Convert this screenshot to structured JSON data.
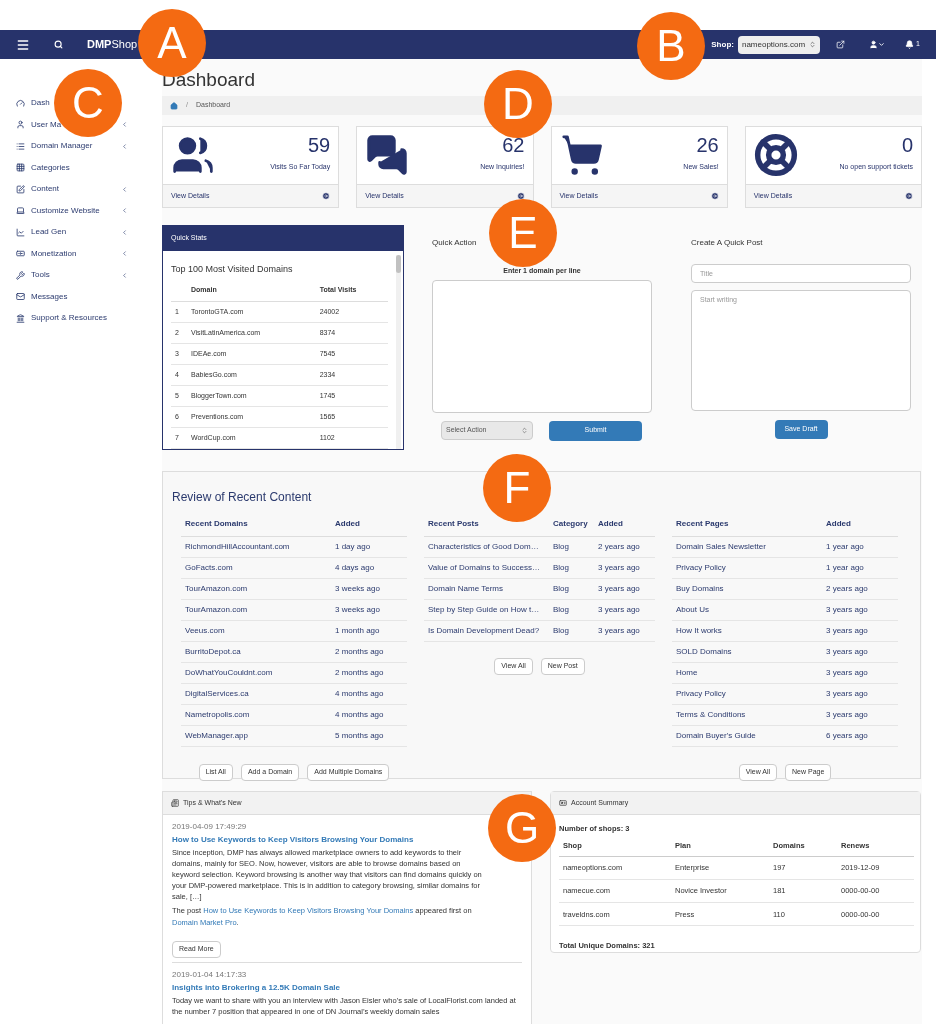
{
  "navbar": {
    "brand_bold": "DMP",
    "brand_light": "Shop",
    "shop_label": "Shop:",
    "shop_value": "nameoptions.com",
    "notification_count": "1"
  },
  "callouts": [
    "A",
    "B",
    "C",
    "D",
    "E",
    "F",
    "G"
  ],
  "sidebar": {
    "items": [
      {
        "label": "Dash",
        "has_submenu": false
      },
      {
        "label": "User Ma",
        "has_submenu": true
      },
      {
        "label": "Domain Manager",
        "has_submenu": true
      },
      {
        "label": "Categories",
        "has_submenu": false
      },
      {
        "label": "Content",
        "has_submenu": true
      },
      {
        "label": "Customize Website",
        "has_submenu": true
      },
      {
        "label": "Lead Gen",
        "has_submenu": true
      },
      {
        "label": "Monetization",
        "has_submenu": true
      },
      {
        "label": "Tools",
        "has_submenu": true
      },
      {
        "label": "Messages",
        "has_submenu": false
      },
      {
        "label": "Support & Resources",
        "has_submenu": false
      }
    ]
  },
  "page_title": "Dashboard",
  "breadcrumb": {
    "separator": "/",
    "items": [
      "Dashboard"
    ]
  },
  "stat_cards": [
    {
      "value": "59",
      "caption": "Visits So Far Today",
      "link": "View Details"
    },
    {
      "value": "62",
      "caption": "New Inquiries!",
      "link": "View Details"
    },
    {
      "value": "26",
      "caption": "New Sales!",
      "link": "View Details"
    },
    {
      "value": "0",
      "caption": "No open support tickets",
      "link": "View Details"
    }
  ],
  "quick_stats": {
    "title": "Quick Stats",
    "heading": "Top 100 Most Visited Domains",
    "columns": [
      "",
      "Domain",
      "Total Visits"
    ],
    "rows": [
      [
        "1",
        "TorontoGTA.com",
        "24002"
      ],
      [
        "2",
        "VisitLatinAmerica.com",
        "8374"
      ],
      [
        "3",
        "IDEAe.com",
        "7545"
      ],
      [
        "4",
        "BabiesGo.com",
        "2334"
      ],
      [
        "5",
        "BloggerTown.com",
        "1745"
      ],
      [
        "6",
        "Preventions.com",
        "1565"
      ],
      [
        "7",
        "WordCup.com",
        "1102"
      ]
    ]
  },
  "quick_action": {
    "title": "Quick Action",
    "hint": "Enter 1 domain per line",
    "select": "Select Action",
    "button": "Submit"
  },
  "quick_post": {
    "title": "Create A Quick Post",
    "title_placeholder": "Title",
    "body_placeholder": "Start writing",
    "button": "Save Draft"
  },
  "review": {
    "title": "Review of Recent Content",
    "domains": {
      "columns": [
        "Recent Domains",
        "Added"
      ],
      "rows": [
        [
          "RichmondHillAccountant.com",
          "1 day ago"
        ],
        [
          "GoFacts.com",
          "4 days ago"
        ],
        [
          "TourAmazon.com",
          "3 weeks ago"
        ],
        [
          "TourAmazon.com",
          "3 weeks ago"
        ],
        [
          "Veeus.com",
          "1 month ago"
        ],
        [
          "BurritoDepot.ca",
          "2 months ago"
        ],
        [
          "DoWhatYouCouldnt.com",
          "2 months ago"
        ],
        [
          "DigitalServices.ca",
          "4 months ago"
        ],
        [
          "Nametropolis.com",
          "4 months ago"
        ],
        [
          "WebManager.app",
          "5 months ago"
        ]
      ],
      "buttons": [
        "List All",
        "Add a Domain",
        "Add Multiple Domains"
      ]
    },
    "posts": {
      "columns": [
        "Recent Posts",
        "Category",
        "Added"
      ],
      "rows": [
        [
          "Characteristics of Good Dom…",
          "Blog",
          "2 years ago"
        ],
        [
          "Value of Domains to Success…",
          "Blog",
          "3 years ago"
        ],
        [
          "Domain Name Terms",
          "Blog",
          "3 years ago"
        ],
        [
          "Step by Step Guide on How t…",
          "Blog",
          "3 years ago"
        ],
        [
          "Is Domain Development Dead?",
          "Blog",
          "3 years ago"
        ]
      ],
      "buttons": [
        "View All",
        "New Post"
      ]
    },
    "pages": {
      "columns": [
        "Recent Pages",
        "Added"
      ],
      "rows": [
        [
          "Domain Sales Newsletter",
          "1 year ago"
        ],
        [
          "Privacy Policy",
          "1 year ago"
        ],
        [
          "Buy Domains",
          "2 years ago"
        ],
        [
          "About Us",
          "3 years ago"
        ],
        [
          "How It works",
          "3 years ago"
        ],
        [
          "SOLD Domains",
          "3 years ago"
        ],
        [
          "Home",
          "3 years ago"
        ],
        [
          "Privacy Policy",
          "3 years ago"
        ],
        [
          "Terms & Conditions",
          "3 years ago"
        ],
        [
          "Domain Buyer's Guide",
          "6 years ago"
        ]
      ],
      "buttons": [
        "View All",
        "New Page"
      ]
    }
  },
  "tips": {
    "title": "Tips & What's New",
    "posts": [
      {
        "date": "2019-04-09 17:49:29",
        "title": "How to Use Keywords to Keep Visitors Browsing Your Domains",
        "excerpt": "Since inception, DMP has always allowed marketplace owners to add keywords to their domains, mainly for SEO. Now, however, visitors are able to browse domains based on keyword selection. Keyword browsing is another way that visitors can find domains quickly on your DMP-powered marketplace. This is in addition to category browsing, similar domains for sale, […]",
        "source": {
          "before": "The post",
          "link": "How to Use Keywords to Keep Visitors Browsing Your Domains",
          "middle": "appeared first on",
          "site": "Domain Market Pro",
          "after": "."
        },
        "button": "Read More"
      },
      {
        "date": "2019-01-04 14:17:33",
        "title": "Insights into Brokering a 12.5K Domain Sale",
        "excerpt": "Today we want to share with you an interview with Jason Eisler who’s sale of LocalFlorist.com landed at the number 7 position that appeared in one of DN Journal’s weekly domain sales"
      }
    ]
  },
  "account": {
    "title": "Account Summary",
    "shops_label": "Number of shops: 3",
    "columns": [
      "Shop",
      "Plan",
      "Domains",
      "Renews"
    ],
    "rows": [
      [
        "nameoptions.com",
        "Enterprise",
        "197",
        "2019-12-09"
      ],
      [
        "namecue.com",
        "Novice Investor",
        "181",
        "0000-00-00"
      ],
      [
        "traveldns.com",
        "Press",
        "110",
        "0000-00-00"
      ]
    ],
    "total": "Total Unique Domains: 321"
  }
}
